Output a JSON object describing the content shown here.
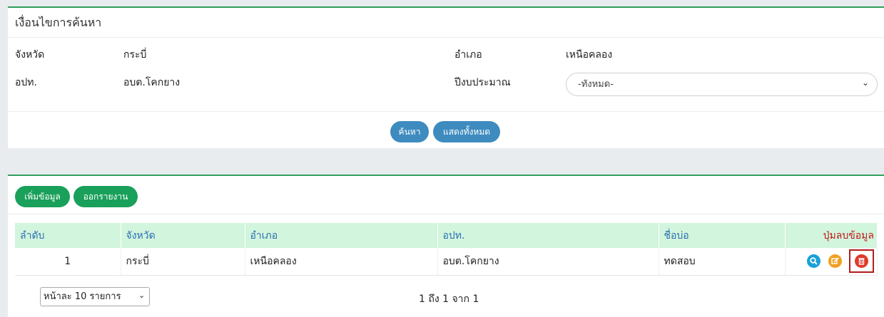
{
  "search": {
    "title": "เงื่อนไขการค้นหา",
    "province_label": "จังหวัด",
    "province_value": "กระบี่",
    "district_label": "อำเภอ",
    "district_value": "เหนือคลอง",
    "lao_label": "อปท.",
    "lao_value": "อบต.โคกยาง",
    "budget_label": "ปีงบประมาณ",
    "budget_selected": "-ทั้งหมด-",
    "search_button": "ค้นหา",
    "show_all_button": "แสดงทั้งหมด"
  },
  "toolbar": {
    "add_button": "เพิ่มข้อมูล",
    "report_button": "ออกรายงาน"
  },
  "table": {
    "headers": [
      "ลำดับ",
      "จังหวัด",
      "อำเภอ",
      "อปท.",
      "ชื่อบ่อ",
      "ปุ่มลบข้อมูล"
    ],
    "rows": [
      {
        "no": "1",
        "province": "กระบี่",
        "district": "เหนือคลอง",
        "lao": "อบต.โคกยาง",
        "pond_name": "ทดสอบ"
      }
    ]
  },
  "icons": {
    "view": "search-icon",
    "edit": "edit-icon",
    "delete": "trash-icon"
  },
  "colors": {
    "accent_green": "#19a05a",
    "button_blue": "#3e8bbf",
    "header_bg": "#d2f5dd",
    "delete_red": "#e03a2b"
  },
  "pagination": {
    "page_size_selected": "หน้าละ 10 รายการ",
    "info": "1 ถึง 1 จาก 1"
  }
}
